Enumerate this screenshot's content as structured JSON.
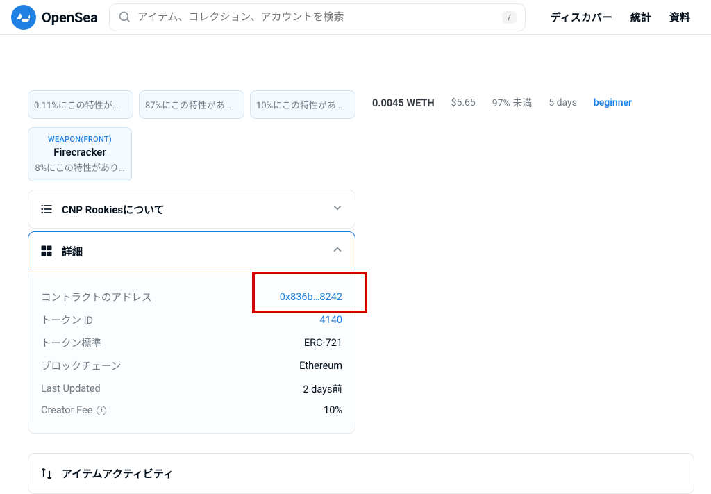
{
  "header": {
    "logo_text": "OpenSea",
    "search_placeholder": "アイテム、コレクション、アカウントを検索",
    "shortcut": "/",
    "nav": {
      "discover": "ディスカバー",
      "stats": "統計",
      "resources": "資料"
    }
  },
  "traits": {
    "row1": [
      {
        "category": "",
        "value": "",
        "rarity": "0.11%にこの特性があ…"
      },
      {
        "category": "",
        "value": "",
        "rarity": "87%にこの特性があり…"
      },
      {
        "category": "",
        "value": "",
        "rarity": "10%にこの特性があり…"
      }
    ],
    "row2": {
      "category": "WEAPON(FRONT)",
      "value": "Firecracker",
      "rarity": "8%にこの特性があり…"
    }
  },
  "about": {
    "title": "CNP Rookiesについて"
  },
  "details": {
    "title": "詳細",
    "contract_label": "コントラクトのアドレス",
    "contract_value": "0x836b…8242",
    "token_id_label": "トークン ID",
    "token_id_value": "4140",
    "token_std_label": "トークン標準",
    "token_std_value": "ERC-721",
    "chain_label": "ブロックチェーン",
    "chain_value": "Ethereum",
    "updated_label": "Last Updated",
    "updated_value": "2 days前",
    "fee_label": "Creator Fee",
    "fee_value": "10%"
  },
  "activity": {
    "title": "アイテムアクティビティ"
  },
  "offer": {
    "price": "0.0045 WETH",
    "usd": "$5.65",
    "floor": "97% 未満",
    "expiration": "5 days",
    "from": "beginner"
  }
}
